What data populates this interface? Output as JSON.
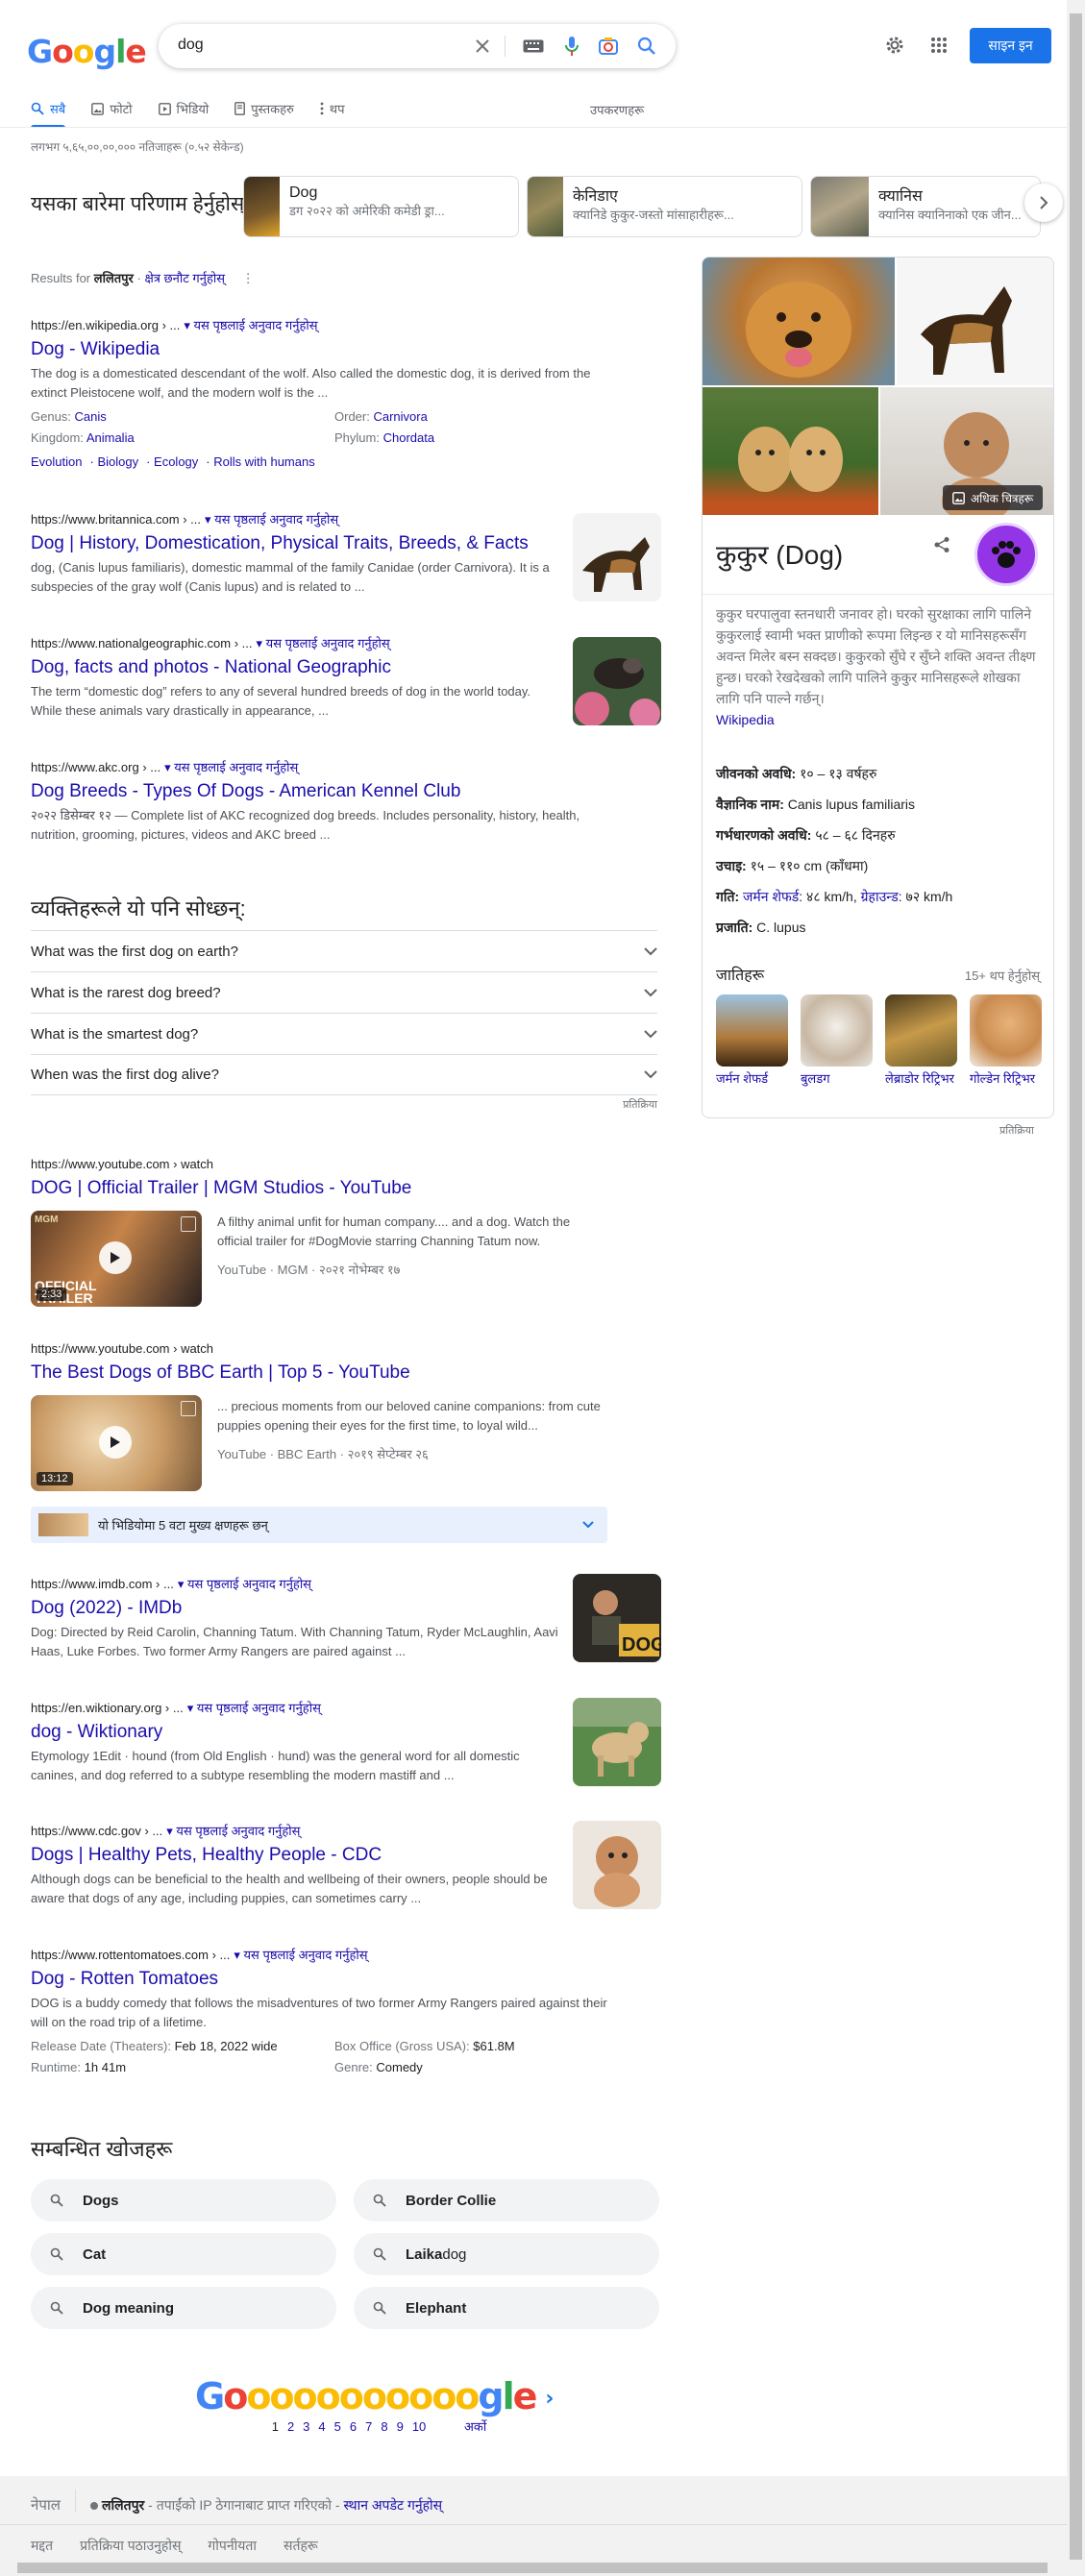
{
  "logo": [
    "G",
    "o",
    "o",
    "g",
    "l",
    "e"
  ],
  "search": {
    "query": "dog"
  },
  "header": {
    "signin": "साइन इन"
  },
  "tabs": [
    {
      "label": "सबै",
      "icon": "search-icon"
    },
    {
      "label": "फोटो",
      "icon": "image-icon"
    },
    {
      "label": "भिडियो",
      "icon": "video-icon"
    },
    {
      "label": "पुस्तकहरु",
      "icon": "book-icon"
    },
    {
      "label": "थप",
      "icon": "more-vertical-icon"
    }
  ],
  "tools": "उपकरणहरू",
  "stats": "लगभग ५,६५,००,००,००० नतिजाहरू (०.५२ सेकेन्ड)",
  "about": {
    "title": "यसका बारेमा परिणाम हेर्नुहोस्",
    "chips": [
      {
        "title": "Dog",
        "sub": "डग २०२२ को अमेरिकी कमेडी ड्रा..."
      },
      {
        "title": "केनिडाए",
        "sub": "क्यानिडे कुकुर-जस्तो मांसाहारीहरू..."
      },
      {
        "title": "क्यानिस",
        "sub": "क्यानिस क्यानिनाको एक जीन..."
      }
    ]
  },
  "results_for": {
    "prefix": "Results for",
    "place": "ललितपुर",
    "change": "क्षेत्र छनौट गर्नुहोस्"
  },
  "translate": "यस पृष्ठलाई अनुवाद गर्नुहोस्",
  "results": [
    {
      "url": "https://en.wikipedia.org › ...",
      "title": "Dog - Wikipedia",
      "snippet": "The dog is a domesticated descendant of the wolf. Also called the domestic dog, it is derived from the extinct Pleistocene wolf, and the modern wolf is the ...",
      "facts": [
        [
          "Genus:",
          "Canis"
        ],
        [
          "Order:",
          "Carnivora"
        ],
        [
          "Kingdom:",
          "Animalia"
        ],
        [
          "Phylum:",
          "Chordata"
        ]
      ],
      "sitelinks": [
        "Evolution",
        "Biology",
        "Ecology",
        "Rolls with humans"
      ]
    },
    {
      "url": "https://www.britannica.com › ...",
      "title": "Dog | History, Domestication, Physical Traits, Breeds, & Facts",
      "snippet": "dog, (Canis lupus familiaris), domestic mammal of the family Canidae (order Carnivora). It is a subspecies of the gray wolf (Canis lupus) and is related to ..."
    },
    {
      "url": "https://www.nationalgeographic.com › ...",
      "title": "Dog, facts and photos - National Geographic",
      "snippet": "The term “domestic dog” refers to any of several hundred breeds of dog in the world today. While these animals vary drastically in appearance, ..."
    },
    {
      "url": "https://www.akc.org › ...",
      "title": "Dog Breeds - Types Of Dogs - American Kennel Club",
      "snippet": "२०२२ डिसेम्बर १२ — Complete list of AKC recognized dog breeds. Includes personality, history, health, nutrition, grooming, pictures, videos and AKC breed ..."
    }
  ],
  "paa": {
    "title": "व्यक्तिहरूले यो पनि सोध्छन्:",
    "questions": [
      "What was the first dog on earth?",
      "What is the rarest dog breed?",
      "What is the smartest dog?",
      "When was the first dog alive?"
    ],
    "feedback": "प्रतिक्रिया"
  },
  "videos": [
    {
      "url": "https://www.youtube.com › watch",
      "title": "DOG | Official Trailer | MGM Studios - YouTube",
      "snippet": "A filthy animal unfit for human company.... and a dog. Watch the official trailer for #DogMovie starring Channing Tatum now.",
      "meta": "YouTube · MGM · २०२१ नोभेम्बर १७",
      "duration": "2:33",
      "thumb_text": "OFFICIAL TRAILER"
    },
    {
      "url": "https://www.youtube.com › watch",
      "title": "The Best Dogs of BBC Earth | Top 5 - YouTube",
      "snippet": "... precious moments from our beloved canine companions: from cute puppies opening their eyes for the first time, to loyal wild...",
      "meta": "YouTube · BBC Earth · २०१९ सेप्टेम्बर २६",
      "duration": "13:12"
    }
  ],
  "key_moments": "यो भिडियोमा 5 वटा मुख्य क्षणहरू छन्",
  "results2": [
    {
      "url": "https://www.imdb.com › ...",
      "title": "Dog (2022) - IMDb",
      "snippet": "Dog: Directed by Reid Carolin, Channing Tatum. With Channing Tatum, Ryder McLaughlin, Aavi Haas, Luke Forbes. Two former Army Rangers are paired against ..."
    },
    {
      "url": "https://en.wiktionary.org › ...",
      "title": "dog - Wiktionary",
      "snippet": "Etymology 1Edit · hound (from Old English · hund) was the general word for all domestic canines, and dog referred to a subtype resembling the modern mastiff and ..."
    },
    {
      "url": "https://www.cdc.gov › ...",
      "title": "Dogs | Healthy Pets, Healthy People - CDC",
      "snippet": "Although dogs can be beneficial to the health and wellbeing of their owners, people should be aware that dogs of any age, including puppies, can sometimes carry ..."
    },
    {
      "url": "https://www.rottentomatoes.com › ...",
      "title": "Dog - Rotten Tomatoes",
      "snippet": "DOG is a buddy comedy that follows the misadventures of two former Army Rangers paired against their will on the road trip of a lifetime.",
      "facts": [
        [
          "Release Date (Theaters):",
          "Feb 18, 2022 wide"
        ],
        [
          "Box Office (Gross USA):",
          "$61.8M"
        ],
        [
          "Runtime:",
          "1h 41m"
        ],
        [
          "Genre:",
          "Comedy"
        ]
      ]
    }
  ],
  "related": {
    "title": "सम्बन्धित खोजहरू",
    "items": [
      {
        "bold": "Dogs",
        "rest": ""
      },
      {
        "bold": "Border Collie",
        "rest": ""
      },
      {
        "bold": "Cat",
        "rest": ""
      },
      {
        "bold": "Laika",
        "rest": " dog"
      },
      {
        "bold": "Dog meaning",
        "rest": ""
      },
      {
        "bold": "Elephant",
        "rest": ""
      }
    ]
  },
  "pager": {
    "letters": [
      "G",
      "o",
      "o",
      "o",
      "o",
      "o",
      "o",
      "o",
      "o",
      "o",
      "o",
      "o",
      "g",
      "l",
      "e"
    ],
    "pages": [
      "1",
      "2",
      "3",
      "4",
      "5",
      "6",
      "7",
      "8",
      "9",
      "10"
    ],
    "next": "अर्को"
  },
  "footer": {
    "country": "नेपाल",
    "location": "ललितपुर",
    "loc_note": " - तपाईंको IP ठेगानाबाट प्राप्त गरिएको - ",
    "update": "स्थान अपडेट गर्नुहोस्",
    "links": [
      "मद्दत",
      "प्रतिक्रिया पठाउनुहोस्",
      "गोपनीयता",
      "सर्तहरू"
    ]
  },
  "kp": {
    "more_images": "अधिक चित्रहरू",
    "title": "कुकुर (Dog)",
    "desc": "कुकुर घरपालुवा स्तनधारी जनावर हो। घरको सुरक्षाका लागि पालिने कुकुरलाई स्वामी भक्त प्राणीको रूपमा लिइन्छ र यो मानिसहरूसँग अवन्त मिलेर बस्न सक्दछ। कुकुरको सुँघे र सुँघ्ने शक्ति अवन्त तीक्ष्ण हुन्छ। घरको रेखदेखको लागि पालिने कुकुर मानिसहरूले शोखका लागि पनि पाल्ने गर्छन्।",
    "source": "Wikipedia",
    "facts": [
      {
        "label": "जीवनको अवधि:",
        "value": " १० – १३ वर्षहरु"
      },
      {
        "label": "वैज्ञानिक नाम:",
        "value": " Canis lupus familiaris"
      },
      {
        "label": "गर्भधारणको अवधि:",
        "value": " ५८ – ६८ दिनहरु"
      },
      {
        "label": "उचाइ:",
        "value": " १५ – ११० cm (काँधमा)"
      },
      {
        "label": "प्रजाति:",
        "value": " C. lupus"
      }
    ],
    "speed": {
      "label": "गति:",
      "l1": "जर्मन शेफर्ड",
      "v1": ": ४८ km/h,",
      "l2": "ग्रेहाउन्ड",
      "v2": ": ७२ km/h"
    },
    "breeds_title": "जातिहरू",
    "breeds_more": "15+ थप हेर्नुहोस्",
    "breeds": [
      "जर्मन शेफर्ड",
      "बुलडग",
      "लेब्राडोर रिट्रिभर",
      "गोल्डेन रिट्रिभर"
    ],
    "feedback": "प्रतिक्रिया"
  },
  "colors": {
    "link": "#1a0dab",
    "blue": "#1a73e8",
    "text": "#202124",
    "muted": "#70757a"
  }
}
